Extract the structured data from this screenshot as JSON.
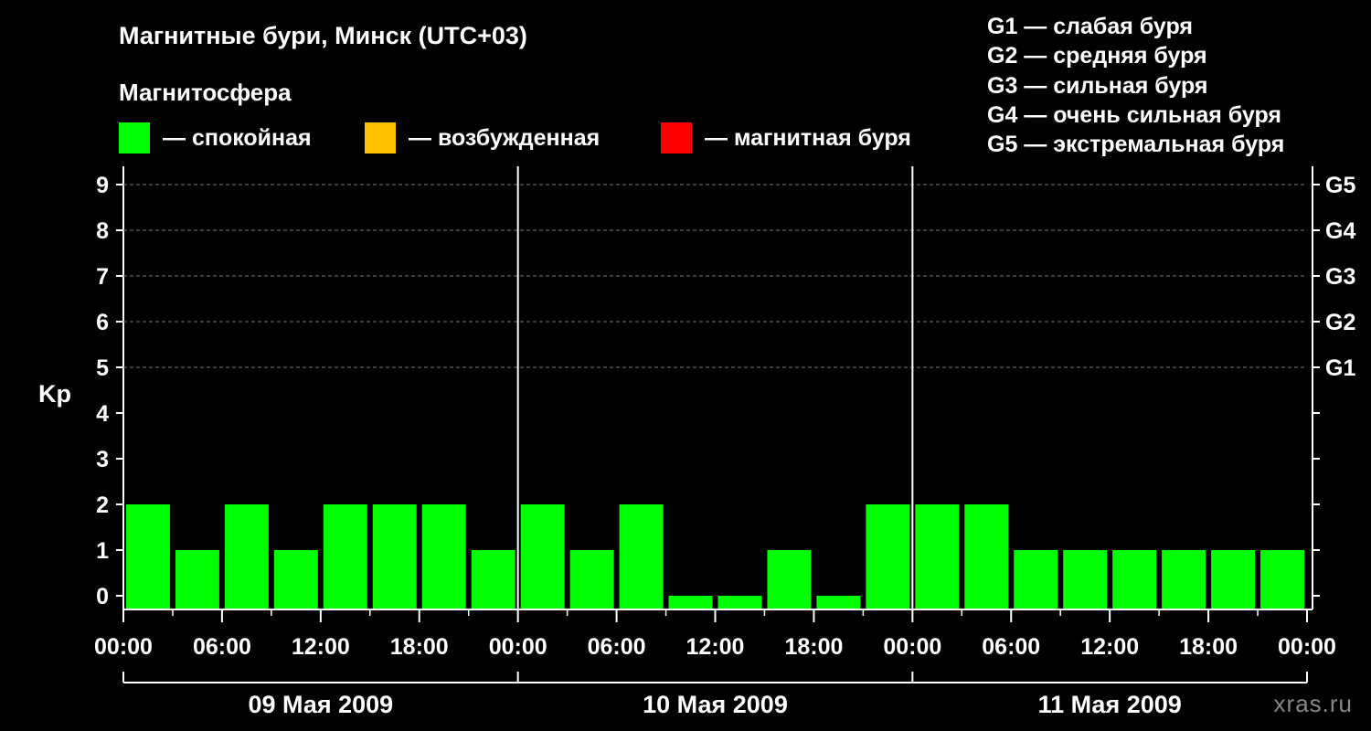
{
  "header": {
    "title": "Магнитные бури, Минск (UTC+03)",
    "subtitle": "Магнитосфера",
    "legend": [
      {
        "label": "— спокойная",
        "color": "#00ff00"
      },
      {
        "label": "— возбужденная",
        "color": "#ffc000"
      },
      {
        "label": "— магнитная буря",
        "color": "#ff0000"
      }
    ],
    "g_legend": [
      "G1 — слабая буря",
      "G2 — средняя буря",
      "G3 — сильная буря",
      "G4 — очень сильная буря",
      "G5 — экстремальная буря"
    ],
    "watermark": "xras.ru"
  },
  "chart_data": {
    "type": "bar",
    "ylabel": "Kp",
    "ylim": [
      0,
      9
    ],
    "y_ticks": [
      "0",
      "1",
      "2",
      "3",
      "4",
      "5",
      "6",
      "7",
      "8",
      "9"
    ],
    "g_ticks": [
      {
        "value": 5,
        "label": "G1"
      },
      {
        "value": 6,
        "label": "G2"
      },
      {
        "value": 7,
        "label": "G3"
      },
      {
        "value": 8,
        "label": "G4"
      },
      {
        "value": 9,
        "label": "G5"
      }
    ],
    "x_tick_labels": [
      "00:00",
      "06:00",
      "12:00",
      "18:00",
      "00:00",
      "06:00",
      "12:00",
      "18:00",
      "00:00",
      "06:00",
      "12:00",
      "18:00",
      "00:00"
    ],
    "days": [
      "09 Мая 2009",
      "10 Мая 2009",
      "11 Мая 2009"
    ],
    "interval_hours": 3,
    "values": [
      2,
      1,
      2,
      1,
      2,
      2,
      2,
      1,
      2,
      1,
      2,
      0,
      0,
      1,
      0,
      2,
      2,
      2,
      1,
      1,
      1,
      1,
      1,
      1
    ],
    "bar_color": "#00ff00",
    "grid": "dashed at Kp 5–9"
  }
}
